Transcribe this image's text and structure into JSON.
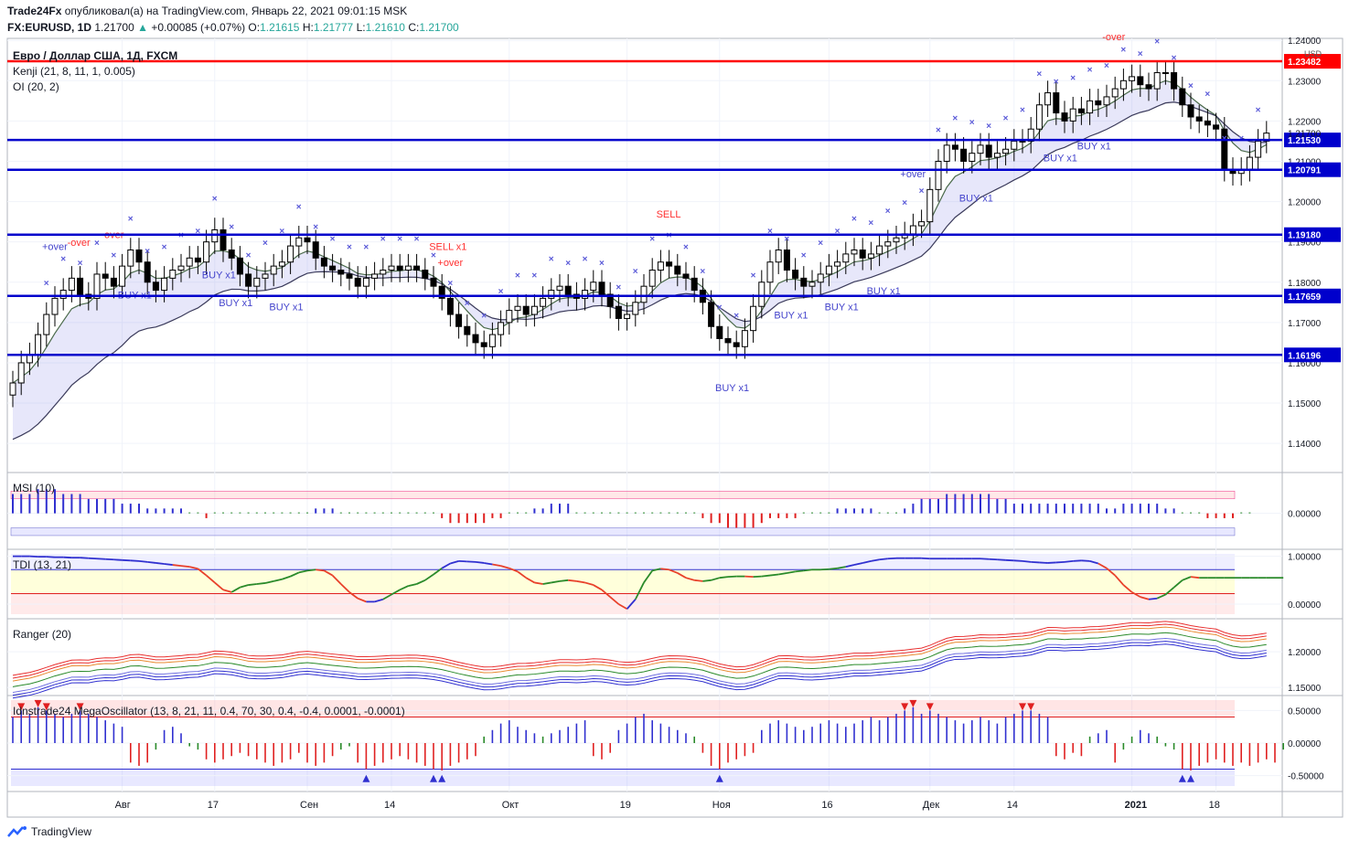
{
  "header": {
    "publisher": "Trade24Fx",
    "published_text": "опубликовал(а) на TradingView.com, Январь 22, 2021 09:01:15 MSK",
    "symbol": "FX:EURUSD, 1D",
    "last": "1.21700",
    "change": "+0.00085 (+0.07%)",
    "o_label": "O:",
    "o": "1.21615",
    "h_label": "H:",
    "h": "1.21777",
    "l_label": "L:",
    "l": "1.21610",
    "c_label": "C:",
    "c": "1.21700"
  },
  "brand": "TradingView",
  "chart_data": {
    "type": "candlestick",
    "title": "Евро / Доллар США, 1Д, FXCM",
    "indicators": [
      "Kenji (21, 8, 11, 1, 0.005)",
      "OI (20, 2)"
    ],
    "currency": "USD",
    "price_axis": {
      "range": [
        1.133,
        1.2405
      ],
      "ticks": [
        "1.24000",
        "1.23000",
        "1.22000",
        "1.21000",
        "1.20000",
        "1.19000",
        "1.18000",
        "1.17000",
        "1.16000",
        "1.15000",
        "1.14000"
      ],
      "current_price": "1.21700"
    },
    "date_axis": {
      "labels": [
        {
          "i": 13,
          "t": "Авг"
        },
        {
          "i": 24,
          "t": "17"
        },
        {
          "i": 35,
          "t": "Сен"
        },
        {
          "i": 45,
          "t": "14"
        },
        {
          "i": 59,
          "t": "Окт"
        },
        {
          "i": 73,
          "t": "19"
        },
        {
          "i": 84,
          "t": "Ноя"
        },
        {
          "i": 97,
          "t": "16"
        },
        {
          "i": 109,
          "t": "Дек"
        },
        {
          "i": 119,
          "t": "14"
        },
        {
          "i": 133,
          "t": "2021"
        },
        {
          "i": 143,
          "t": "18"
        }
      ]
    },
    "levels": [
      {
        "price": 1.23482,
        "label": "1.23482",
        "color": "#ff0000"
      },
      {
        "price": 1.2153,
        "label": "1.21530",
        "color": "#0000cc"
      },
      {
        "price": 1.20791,
        "label": "1.20791",
        "color": "#0000cc"
      },
      {
        "price": 1.1918,
        "label": "1.19180",
        "color": "#0000cc"
      },
      {
        "price": 1.17659,
        "label": "1.17659",
        "color": "#0000cc"
      },
      {
        "price": 1.16196,
        "label": "1.16196",
        "color": "#0000cc"
      }
    ],
    "close": [
      1.155,
      1.16,
      1.162,
      1.167,
      1.172,
      1.176,
      1.178,
      1.181,
      1.177,
      1.176,
      1.182,
      1.181,
      1.179,
      1.184,
      1.188,
      1.185,
      1.18,
      1.178,
      1.181,
      1.183,
      1.184,
      1.186,
      1.185,
      1.19,
      1.193,
      1.188,
      1.186,
      1.182,
      1.179,
      1.181,
      1.182,
      1.184,
      1.185,
      1.189,
      1.191,
      1.19,
      1.186,
      1.184,
      1.183,
      1.182,
      1.181,
      1.179,
      1.181,
      1.182,
      1.183,
      1.184,
      1.183,
      1.184,
      1.183,
      1.181,
      1.179,
      1.176,
      1.172,
      1.169,
      1.167,
      1.165,
      1.164,
      1.167,
      1.17,
      1.173,
      1.174,
      1.172,
      1.174,
      1.176,
      1.178,
      1.179,
      1.177,
      1.176,
      1.178,
      1.18,
      1.177,
      1.174,
      1.171,
      1.172,
      1.175,
      1.179,
      1.183,
      1.185,
      1.184,
      1.182,
      1.181,
      1.178,
      1.175,
      1.169,
      1.166,
      1.165,
      1.164,
      1.168,
      1.174,
      1.18,
      1.185,
      1.188,
      1.183,
      1.181,
      1.179,
      1.18,
      1.182,
      1.184,
      1.185,
      1.187,
      1.188,
      1.186,
      1.187,
      1.189,
      1.19,
      1.191,
      1.192,
      1.194,
      1.195,
      1.203,
      1.21,
      1.214,
      1.213,
      1.21,
      1.212,
      1.214,
      1.211,
      1.212,
      1.213,
      1.215,
      1.215,
      1.218,
      1.224,
      1.227,
      1.222,
      1.22,
      1.223,
      1.222,
      1.225,
      1.224,
      1.226,
      1.228,
      1.23,
      1.231,
      1.229,
      1.228,
      1.232,
      1.232,
      1.228,
      1.224,
      1.221,
      1.22,
      1.219,
      1.218,
      1.208,
      1.207,
      1.208,
      1.211,
      1.215,
      1.217
    ],
    "series": [
      {
        "name": "MSI (10)",
        "range": [
          -0.065,
          0.075
        ],
        "ticks": [
          "0.00000"
        ],
        "values": [
          0.04,
          0.04,
          0.04,
          0.05,
          0.05,
          0.05,
          0.04,
          0.04,
          0.04,
          0.03,
          0.03,
          0.03,
          0.03,
          0.02,
          0.02,
          0.02,
          0.01,
          0.01,
          0.01,
          0.01,
          0.01,
          0.0,
          0.0,
          -0.01,
          0.0,
          0.0,
          0.0,
          0.0,
          0.0,
          0.0,
          0.0,
          0.0,
          0.0,
          0.0,
          0.0,
          0.0,
          0.01,
          0.01,
          0.01,
          0.0,
          0.0,
          0.0,
          0.0,
          0.0,
          0.0,
          0.0,
          0.0,
          0.0,
          0.0,
          0.0,
          0.0,
          -0.01,
          -0.02,
          -0.02,
          -0.02,
          -0.02,
          -0.02,
          -0.01,
          -0.01,
          0.0,
          0.0,
          0.0,
          0.01,
          0.01,
          0.02,
          0.02,
          0.02,
          0.0,
          0.0,
          0.0,
          0.0,
          0.0,
          0.0,
          0.0,
          0.0,
          0.0,
          0.0,
          0.0,
          0.0,
          0.0,
          0.0,
          0.0,
          -0.01,
          -0.02,
          -0.02,
          -0.03,
          -0.03,
          -0.03,
          -0.03,
          -0.02,
          -0.01,
          -0.01,
          -0.01,
          -0.01,
          0.0,
          0.0,
          0.0,
          0.0,
          0.01,
          0.01,
          0.01,
          0.01,
          0.01,
          0.0,
          0.0,
          0.0,
          0.01,
          0.02,
          0.03,
          0.03,
          0.03,
          0.04,
          0.04,
          0.04,
          0.04,
          0.04,
          0.04,
          0.03,
          0.03,
          0.02,
          0.02,
          0.02,
          0.02,
          0.02,
          0.02,
          0.02,
          0.02,
          0.02,
          0.02,
          0.02,
          0.01,
          0.01,
          0.02,
          0.02,
          0.02,
          0.02,
          0.02,
          0.01,
          0.01,
          0.0,
          0.0,
          0.0,
          -0.01,
          -0.01,
          -0.01,
          -0.01,
          0.0,
          0.0
        ]
      },
      {
        "name": "TDI (13, 21)",
        "range": [
          -0.21,
          1.05
        ],
        "ticks": [
          "1.00000",
          "0.00000"
        ],
        "values": [
          1.0,
          1.0,
          1.0,
          0.99,
          0.99,
          0.98,
          0.98,
          0.97,
          0.97,
          0.96,
          0.95,
          0.94,
          0.93,
          0.92,
          0.91,
          0.9,
          0.88,
          0.86,
          0.84,
          0.82,
          0.8,
          0.78,
          0.74,
          0.6,
          0.45,
          0.3,
          0.25,
          0.35,
          0.4,
          0.42,
          0.44,
          0.48,
          0.52,
          0.58,
          0.66,
          0.7,
          0.72,
          0.7,
          0.6,
          0.42,
          0.25,
          0.12,
          0.05,
          0.05,
          0.1,
          0.2,
          0.3,
          0.38,
          0.42,
          0.5,
          0.62,
          0.75,
          0.85,
          0.9,
          0.89,
          0.88,
          0.86,
          0.83,
          0.8,
          0.75,
          0.68,
          0.55,
          0.45,
          0.42,
          0.45,
          0.48,
          0.5,
          0.48,
          0.45,
          0.4,
          0.3,
          0.15,
          0.0,
          -0.1,
          0.1,
          0.45,
          0.7,
          0.74,
          0.72,
          0.65,
          0.55,
          0.5,
          0.48,
          0.5,
          0.55,
          0.57,
          0.58,
          0.58,
          0.57,
          0.58,
          0.6,
          0.62,
          0.65,
          0.68,
          0.7,
          0.72,
          0.72,
          0.73,
          0.75,
          0.78,
          0.82,
          0.86,
          0.9,
          0.93,
          0.95,
          0.96,
          0.96,
          0.96,
          0.96,
          0.95,
          0.95,
          0.95,
          0.95,
          0.95,
          0.95,
          0.95,
          0.94,
          0.93,
          0.92,
          0.91,
          0.9,
          0.88,
          0.87,
          0.86,
          0.87,
          0.88,
          0.9,
          0.91,
          0.9,
          0.85,
          0.75,
          0.6,
          0.4,
          0.25,
          0.15,
          0.1,
          0.12,
          0.2,
          0.35,
          0.5,
          0.57,
          0.55,
          0.55,
          0.55,
          0.55,
          0.55,
          0.55,
          0.55,
          0.55,
          0.55,
          0.55,
          0.55
        ]
      },
      {
        "name": "Ranger (20)",
        "range": [
          1.145,
          1.24
        ],
        "ticks": [
          "1.20000",
          "1.15000"
        ]
      },
      {
        "name": "Idnstrade24 MegaOscillator (13, 8, 21, 11, 0.4, 70, 30, 0.4, -0.4, 0.0001, -0.0001)",
        "range": [
          -0.66,
          0.66
        ],
        "ticks": [
          "0.50000",
          "0.00000",
          "-0.50000"
        ],
        "values": [
          0.4,
          0.5,
          0.45,
          0.55,
          0.5,
          0.45,
          0.4,
          0.45,
          0.5,
          0.45,
          0.4,
          0.35,
          0.3,
          0.25,
          -0.3,
          -0.35,
          -0.3,
          -0.1,
          0.2,
          0.25,
          0.15,
          -0.05,
          -0.1,
          -0.25,
          -0.3,
          -0.25,
          -0.2,
          -0.15,
          -0.2,
          -0.25,
          -0.3,
          -0.35,
          -0.3,
          -0.25,
          -0.15,
          -0.3,
          -0.35,
          -0.3,
          -0.2,
          -0.1,
          -0.05,
          -0.3,
          -0.4,
          -0.35,
          -0.3,
          -0.25,
          -0.2,
          -0.25,
          -0.3,
          -0.35,
          -0.4,
          -0.42,
          -0.35,
          -0.3,
          -0.25,
          -0.2,
          0.1,
          0.2,
          0.3,
          0.35,
          0.25,
          0.2,
          0.15,
          0.1,
          0.15,
          0.2,
          0.25,
          0.3,
          0.35,
          -0.2,
          -0.25,
          -0.15,
          0.2,
          0.3,
          0.4,
          0.45,
          0.35,
          0.3,
          0.25,
          0.2,
          0.15,
          0.1,
          -0.15,
          -0.35,
          -0.4,
          -0.3,
          -0.25,
          -0.2,
          -0.15,
          0.2,
          0.3,
          0.35,
          0.3,
          0.25,
          0.2,
          0.25,
          0.3,
          0.35,
          0.3,
          0.25,
          0.3,
          0.35,
          0.4,
          0.35,
          0.4,
          0.45,
          0.5,
          0.55,
          0.45,
          0.5,
          0.45,
          0.4,
          0.35,
          0.3,
          0.35,
          0.4,
          0.35,
          0.3,
          0.4,
          0.45,
          0.5,
          0.5,
          0.45,
          0.4,
          -0.2,
          -0.25,
          -0.15,
          -0.2,
          0.1,
          0.15,
          0.2,
          -0.3,
          -0.1,
          0.1,
          0.2,
          0.15,
          0.1,
          -0.05,
          -0.1,
          -0.4,
          -0.42,
          -0.35,
          -0.3,
          -0.25,
          -0.3,
          -0.35,
          -0.3,
          -0.35,
          -0.3,
          -0.25,
          -0.3,
          -0.1
        ]
      }
    ],
    "annotations": [
      {
        "i": 5,
        "text": "+over",
        "color": "#4444cc"
      },
      {
        "i": 14,
        "text": "BUY x1",
        "color": "#4444cc"
      },
      {
        "i": 12,
        "text": "-over",
        "color": "#ff3030"
      },
      {
        "i": 8,
        "text": "-over",
        "color": "#ff3030"
      },
      {
        "i": 24,
        "text": "BUY x1",
        "color": "#4444cc"
      },
      {
        "i": 26,
        "text": "BUY x1",
        "color": "#4444cc"
      },
      {
        "i": 32,
        "text": "BUY x1",
        "color": "#4444cc"
      },
      {
        "i": 51,
        "text": "SELL x1",
        "color": "#ff3030"
      },
      {
        "i": 52,
        "text": "+over",
        "color": "#ff3030"
      },
      {
        "i": 78,
        "text": "SELL",
        "color": "#ff3030"
      },
      {
        "i": 85,
        "text": "BUY x1",
        "color": "#4444cc"
      },
      {
        "i": 92,
        "text": "BUY x1",
        "color": "#4444cc"
      },
      {
        "i": 98,
        "text": "BUY x1",
        "color": "#4444cc"
      },
      {
        "i": 107,
        "text": "+over",
        "color": "#4444cc"
      },
      {
        "i": 103,
        "text": "BUY x1",
        "color": "#4444cc"
      },
      {
        "i": 114,
        "text": "BUY x1",
        "color": "#4444cc"
      },
      {
        "i": 124,
        "text": "BUY x1",
        "color": "#4444cc"
      },
      {
        "i": 128,
        "text": "BUY x1",
        "color": "#4444cc"
      },
      {
        "i": 131,
        "text": "-over",
        "color": "#ff3030"
      }
    ]
  }
}
